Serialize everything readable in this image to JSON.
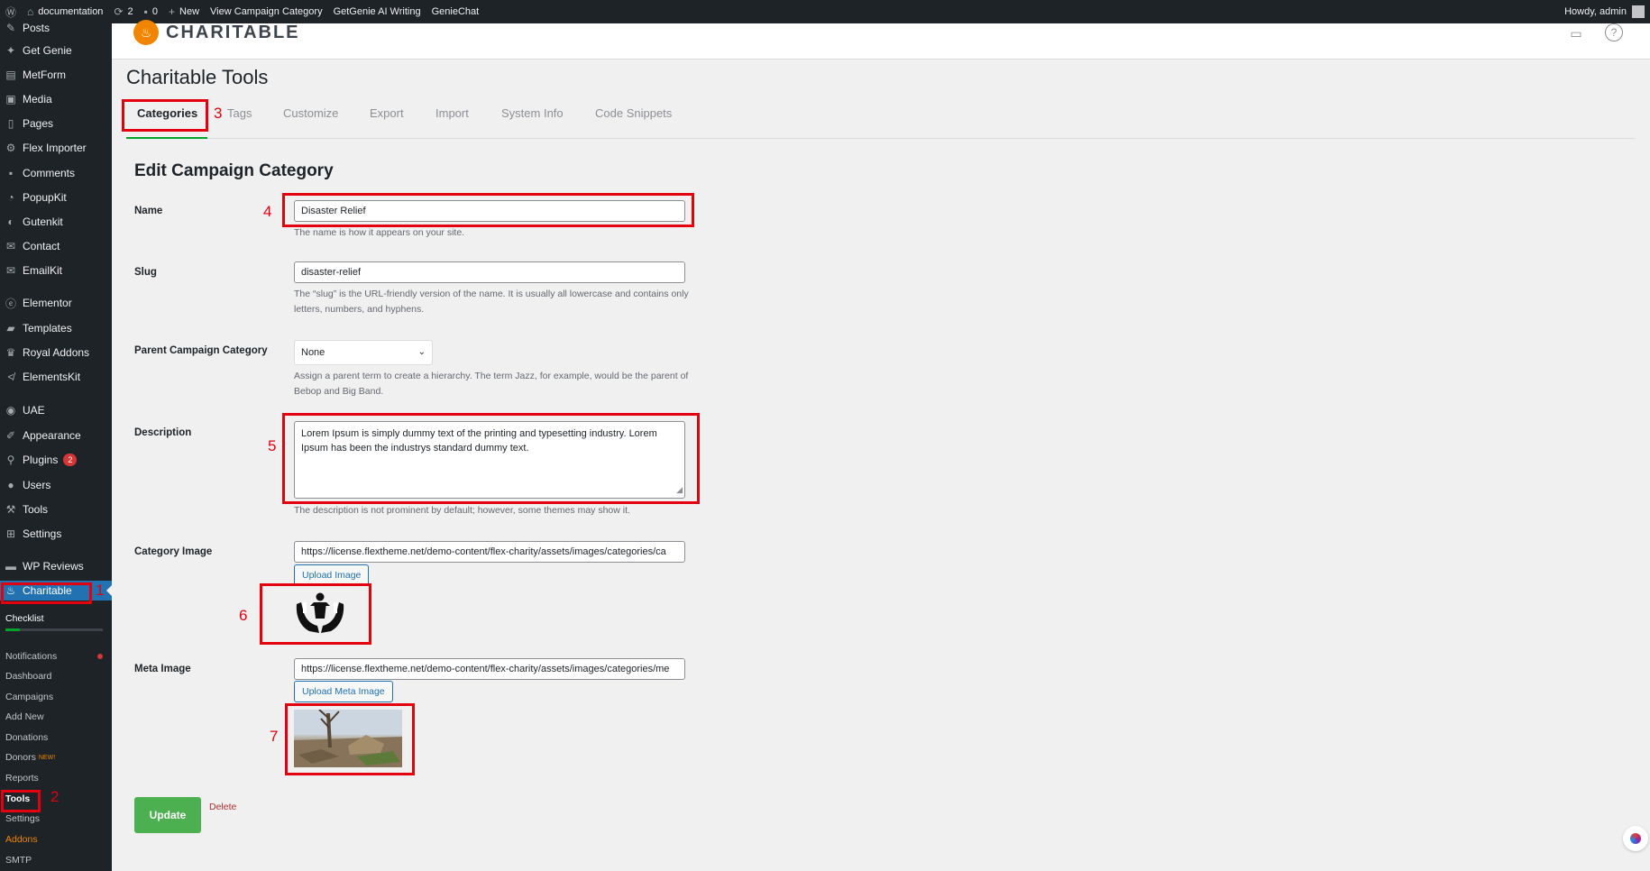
{
  "admin_bar": {
    "site_name": "documentation",
    "updates_count": "2",
    "comments_count": "0",
    "new_label": "New",
    "view_category": "View Campaign Category",
    "getgenie": "GetGenie AI Writing",
    "geniechat": "GenieChat",
    "howdy": "Howdy, admin"
  },
  "sidebar": {
    "items": [
      {
        "label": "Posts",
        "icon": "pin-icon"
      },
      {
        "label": "Get Genie",
        "icon": "genie-icon"
      },
      {
        "label": "MetForm",
        "icon": "form-icon"
      },
      {
        "label": "Media",
        "icon": "media-icon"
      },
      {
        "label": "Pages",
        "icon": "page-icon"
      },
      {
        "label": "Flex Importer",
        "icon": "import-icon"
      },
      {
        "label": "Comments",
        "icon": "comment-icon"
      },
      {
        "label": "PopupKit",
        "icon": "popup-icon"
      },
      {
        "label": "Gutenkit",
        "icon": "gutenkit-icon"
      },
      {
        "label": "Contact",
        "icon": "mail-icon"
      },
      {
        "label": "EmailKit",
        "icon": "email-icon"
      },
      {
        "label": "Elementor",
        "icon": "elementor-icon"
      },
      {
        "label": "Templates",
        "icon": "folder-icon"
      },
      {
        "label": "Royal Addons",
        "icon": "crown-icon"
      },
      {
        "label": "ElementsKit",
        "icon": "ek-icon"
      },
      {
        "label": "UAE",
        "icon": "uae-icon"
      },
      {
        "label": "Appearance",
        "icon": "brush-icon"
      },
      {
        "label": "Plugins",
        "icon": "plug-icon",
        "badge": "2"
      },
      {
        "label": "Users",
        "icon": "user-icon"
      },
      {
        "label": "Tools",
        "icon": "wrench-icon"
      },
      {
        "label": "Settings",
        "icon": "settings-icon"
      },
      {
        "label": "WP Reviews",
        "icon": "review-icon"
      },
      {
        "label": "Charitable",
        "icon": "charitable-icon"
      }
    ],
    "checklist_label": "Checklist",
    "checklist_progress": 0.15,
    "submenu": [
      {
        "label": "Notifications"
      },
      {
        "label": "Dashboard"
      },
      {
        "label": "Campaigns"
      },
      {
        "label": "Add New"
      },
      {
        "label": "Donations"
      },
      {
        "label": "Donors",
        "tag": "NEW!"
      },
      {
        "label": "Reports"
      },
      {
        "label": "Tools"
      },
      {
        "label": "Settings"
      },
      {
        "label": "Addons"
      },
      {
        "label": "SMTP"
      }
    ]
  },
  "header": {
    "brand": "CHARITABLE",
    "brand_color": "#f18500"
  },
  "page": {
    "title": "Charitable Tools",
    "tabs": [
      "Categories",
      "Tags",
      "Customize",
      "Export",
      "Import",
      "System Info",
      "Code Snippets"
    ],
    "section_title": "Edit Campaign Category"
  },
  "form": {
    "name_label": "Name",
    "name_value": "Disaster Relief",
    "name_help": "The name is how it appears on your site.",
    "slug_label": "Slug",
    "slug_value": "disaster-relief",
    "slug_help": "The “slug” is the URL-friendly version of the name. It is usually all lowercase and contains only letters, numbers, and hyphens.",
    "parent_label": "Parent Campaign Category",
    "parent_value": "None",
    "parent_help": "Assign a parent term to create a hierarchy. The term Jazz, for example, would be the parent of Bebop and Big Band.",
    "description_label": "Description",
    "description_value": "Lorem Ipsum is simply dummy text of the printing and typesetting industry. Lorem Ipsum has been the industrys standard dummy text.",
    "description_help": "The description is not prominent by default; however, some themes may show it.",
    "category_image_label": "Category Image",
    "category_image_url": "https://license.flextheme.net/demo-content/flex-charity/assets/images/categories/ca",
    "upload_image_label": "Upload Image",
    "meta_image_label": "Meta Image",
    "meta_image_url": "https://license.flextheme.net/demo-content/flex-charity/assets/images/categories/me",
    "upload_meta_label": "Upload Meta Image",
    "update_label": "Update",
    "delete_label": "Delete"
  },
  "annotations": [
    "1",
    "2",
    "3",
    "4",
    "5",
    "6",
    "7"
  ],
  "colors": {
    "annotation": "#e3000f",
    "update_button": "#4caf50",
    "link": "#2271b1",
    "sidebar_bg": "#1d2327"
  }
}
